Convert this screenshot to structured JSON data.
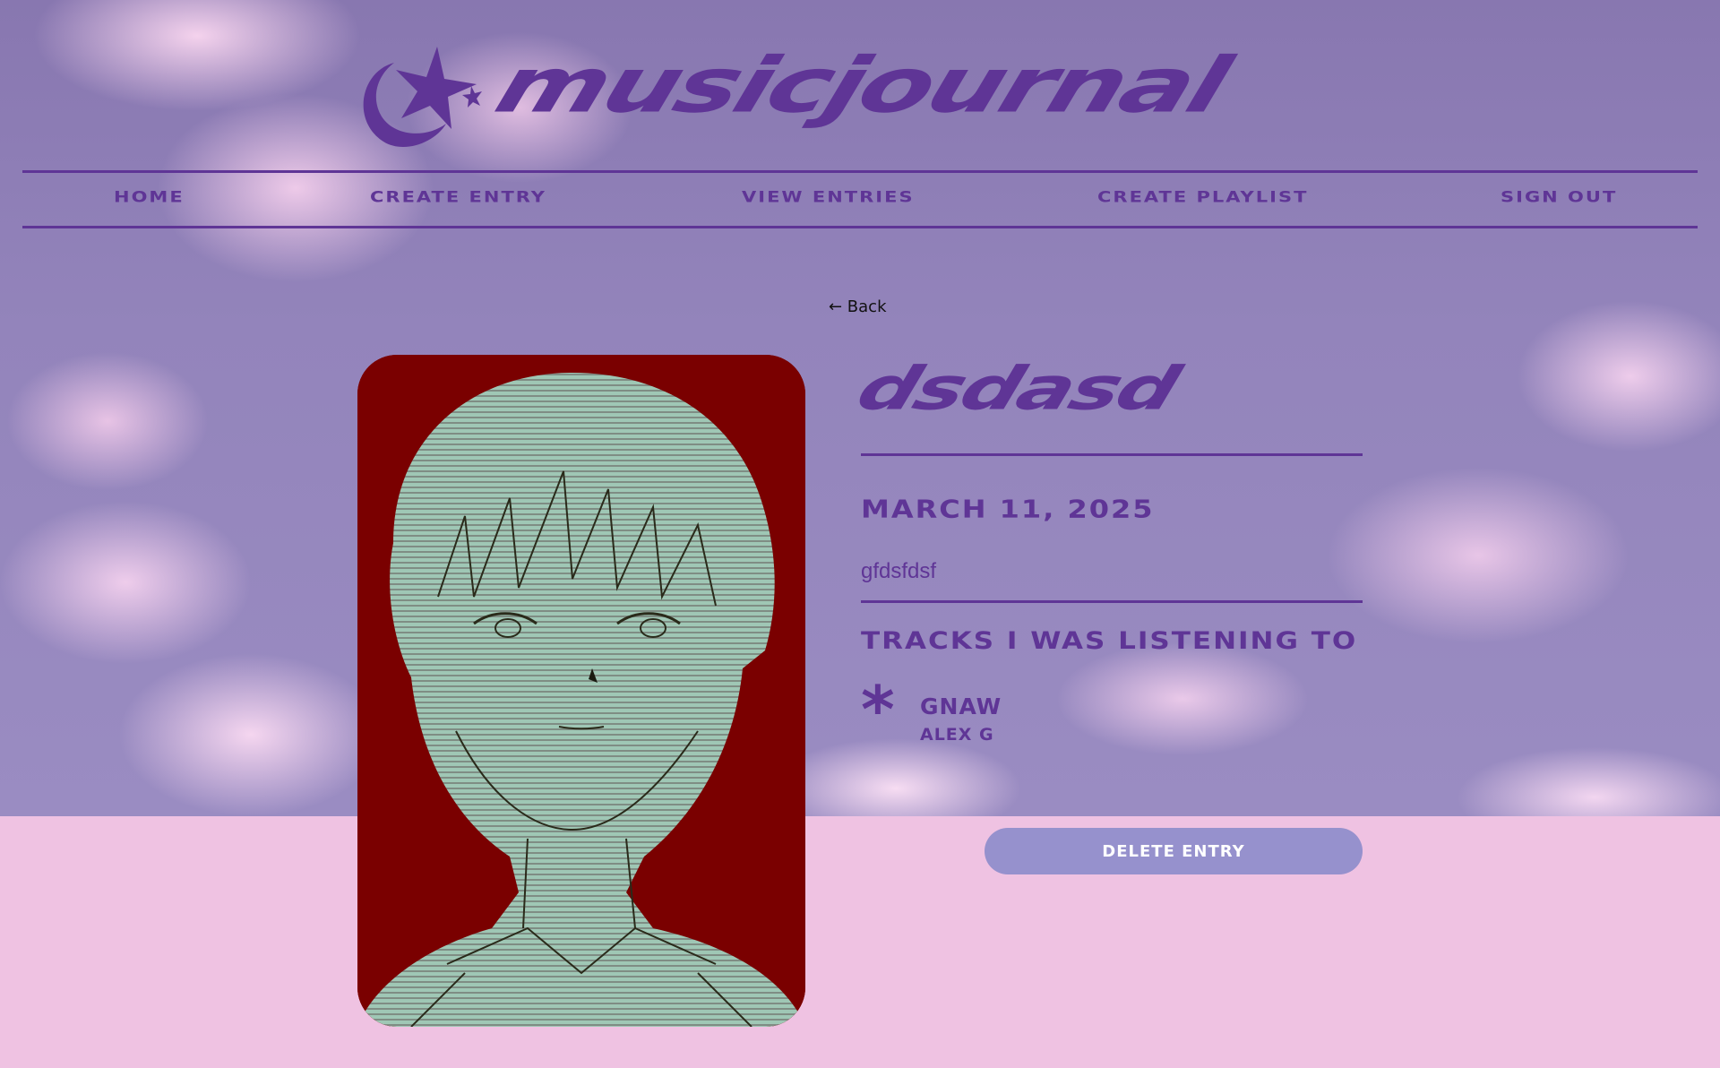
{
  "header": {
    "logo_text": "musicjournal",
    "logo_icon": "moon-star-icon"
  },
  "nav": {
    "items": [
      {
        "label": "Home"
      },
      {
        "label": "Create Entry"
      },
      {
        "label": "View Entries"
      },
      {
        "label": "Create Playlist"
      },
      {
        "label": "Sign Out"
      }
    ]
  },
  "entry": {
    "back_label": "← Back",
    "title": "dsdasd",
    "date": "March 11, 2025",
    "description": "gfdsfdsf",
    "cover_alt": "album-cover-image",
    "tracks_heading": "Tracks I was listening to",
    "tracks": [
      {
        "name": "Gnaw",
        "artist": "Alex G",
        "icon": "asterisk-icon"
      }
    ],
    "delete_label": "Delete Entry"
  },
  "colors": {
    "accent": "#5f3596",
    "button": "#9691cd",
    "page_background": "#efc2e2",
    "sky": "#8f80b8"
  }
}
